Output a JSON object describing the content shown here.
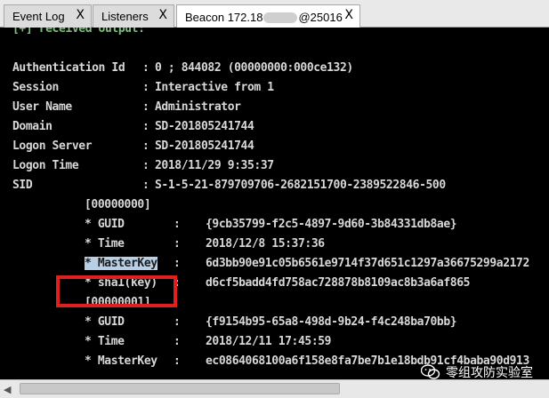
{
  "tabs": [
    {
      "label": "Event Log",
      "close": "X"
    },
    {
      "label": "Listeners",
      "close": "X"
    },
    {
      "label_prefix": "Beacon 172.18",
      "label_suffix": "@25016",
      "close": "X",
      "active": true
    }
  ],
  "console": {
    "partial_first_line": "[+] received output:",
    "rows": [
      {
        "key": "Authentication Id",
        "value": "0 ; 844082 (00000000:000ce132)"
      },
      {
        "key": "Session",
        "value": "Interactive from 1"
      },
      {
        "key": "User Name",
        "value": "Administrator"
      },
      {
        "key": "Domain",
        "value": "SD-201805241744"
      },
      {
        "key": "Logon Server",
        "value": "SD-201805241744"
      },
      {
        "key": "Logon Time",
        "value": "2018/11/29 9:35:37"
      },
      {
        "key": "SID",
        "value": "S-1-5-21-879709706-2682151700-2389522846-500"
      }
    ],
    "keys": [
      {
        "index": "[00000000]",
        "guid_label": "* GUID",
        "guid_value": "{9cb35799-f2c5-4897-9d60-3b84331db8ae}",
        "time_label": "* Time",
        "time_value": "2018/12/8 15:37:36",
        "masterkey_label": "* MasterKey",
        "masterkey_value": "6d3bb90e91c05b6561e9714f37d651c1297a36675299a2172",
        "sha1_label": "* sha1(key)",
        "sha1_value": "d6cf5badd4fd758ac728878b8109ac8b3a6af865"
      },
      {
        "index": "[00000001]",
        "guid_label": "* GUID",
        "guid_value": "{f9154b95-65a8-498d-9b24-f4c248ba70bb}",
        "time_label": "* Time",
        "time_value": "2018/12/11 17:45:59",
        "masterkey_label": "* MasterKey",
        "masterkey_value": "ec0864068100a6f158e8fa7be7b1e18bdb91cf4baba90d913"
      }
    ],
    "separator": ":"
  },
  "watermark": {
    "text": "零组攻防实验室"
  },
  "colors": {
    "highlight": "#b9cfe6",
    "annotation_box": "#e0201e",
    "console_bg": "#000000",
    "console_text": "#d8d8d8"
  }
}
